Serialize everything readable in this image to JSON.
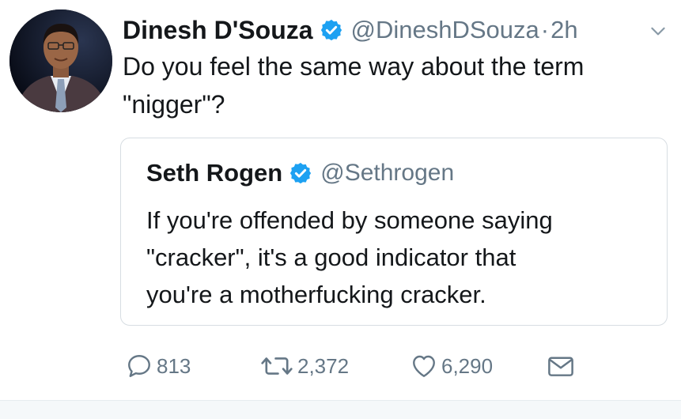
{
  "tweet": {
    "author": {
      "name": "Dinesh D'Souza",
      "handle": "@DineshDSouza",
      "verified": true,
      "avatar_icon": "profile-photo"
    },
    "separator": "·",
    "time": "2h",
    "text": "Do you feel the same way about the term\n\"nigger\"?",
    "menu_icon": "chevron-down-icon"
  },
  "quoted_tweet": {
    "author": {
      "name": "Seth Rogen",
      "handle": "@Sethrogen",
      "verified": true
    },
    "text": "If you're offended by someone saying\n\"cracker\", it's a good indicator that\nyou're a motherfucking cracker."
  },
  "actions": {
    "reply": {
      "icon": "reply-icon",
      "count": "813"
    },
    "retweet": {
      "icon": "retweet-icon",
      "count": "2,372"
    },
    "like": {
      "icon": "heart-icon",
      "count": "6,290"
    },
    "message": {
      "icon": "envelope-icon"
    }
  },
  "colors": {
    "text": "#14171a",
    "secondary": "#657786",
    "verified_badge": "#1da1f2",
    "border": "#d7dde2"
  }
}
